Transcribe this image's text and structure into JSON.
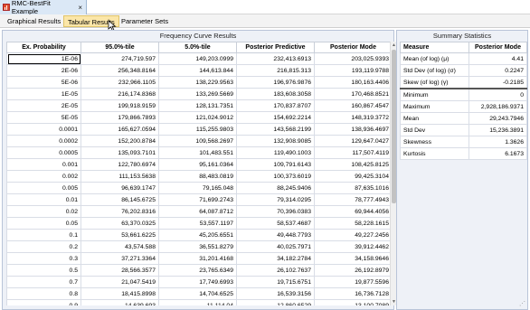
{
  "window": {
    "title": "RMC-BestFit Example",
    "close_glyph": "×"
  },
  "tabs": [
    {
      "label": "Graphical Results"
    },
    {
      "label": "Tabular Results"
    },
    {
      "label": "Parameter Sets"
    }
  ],
  "frequency": {
    "title": "Frequency Curve Results",
    "columns": [
      "Ex. Probability",
      "95.0%-tile",
      "5.0%-tile",
      "Posterior Predictive",
      "Posterior Mode"
    ],
    "rows": [
      [
        "1E-06",
        "274,719.597",
        "149,203.0999",
        "232,413.6913",
        "203,025.9393"
      ],
      [
        "2E-06",
        "256,348.8164",
        "144,613.844",
        "216,815.313",
        "193,119.9788"
      ],
      [
        "5E-06",
        "232,966.1105",
        "138,229.9563",
        "196,976.9876",
        "180,163.4406"
      ],
      [
        "1E-05",
        "216,174.8368",
        "133,269.5669",
        "183,608.3058",
        "170,468.8521"
      ],
      [
        "2E-05",
        "199,918.9159",
        "128,131.7351",
        "170,837.8707",
        "160,867.4547"
      ],
      [
        "5E-05",
        "179,866.7893",
        "121,024.9012",
        "154,692.2214",
        "148,319.3772"
      ],
      [
        "0.0001",
        "165,627.0594",
        "115,255.9803",
        "143,568.2199",
        "138,936.4697"
      ],
      [
        "0.0002",
        "152,200.8784",
        "109,568.2697",
        "132,908.9085",
        "129,647.0427"
      ],
      [
        "0.0005",
        "135,093.7101",
        "101,483.551",
        "119,490.1003",
        "117,507.4119"
      ],
      [
        "0.001",
        "122,780.6974",
        "95,161.0364",
        "109,791.6143",
        "108,425.8125"
      ],
      [
        "0.002",
        "111,153.5638",
        "88,483.0819",
        "100,373.6019",
        "99,425.3104"
      ],
      [
        "0.005",
        "96,639.1747",
        "79,165.048",
        "88,245.9406",
        "87,635.1016"
      ],
      [
        "0.01",
        "86,145.6725",
        "71,699.2743",
        "79,314.0295",
        "78,777.4943"
      ],
      [
        "0.02",
        "76,202.8316",
        "64,087.8712",
        "70,396.0383",
        "69,944.4056"
      ],
      [
        "0.05",
        "63,370.0325",
        "53,557.1197",
        "58,537.4687",
        "58,228.1615"
      ],
      [
        "0.1",
        "53,661.6225",
        "45,205.6551",
        "49,448.7793",
        "49,227.2456"
      ],
      [
        "0.2",
        "43,574.588",
        "36,551.8279",
        "40,025.7971",
        "39,912.4462"
      ],
      [
        "0.3",
        "37,271.3364",
        "31,201.4168",
        "34,182.2784",
        "34,158.9646"
      ],
      [
        "0.5",
        "28,566.3577",
        "23,765.6349",
        "26,102.7637",
        "26,192.8979"
      ],
      [
        "0.7",
        "21,047.5419",
        "17,749.6993",
        "19,715.6751",
        "19,877.5596"
      ],
      [
        "0.8",
        "18,415.8998",
        "14,704.6525",
        "16,539.3156",
        "16,736.7128"
      ],
      [
        "0.9",
        "14,639.693",
        "11,114.04",
        "12,860.6529",
        "13,100.7089"
      ]
    ]
  },
  "summary": {
    "title": "Summary Statistics",
    "columns": [
      "Measure",
      "Posterior Mode"
    ],
    "rows": [
      [
        "Mean (of log) (μ)",
        "4.41"
      ],
      [
        "Std Dev (of log) (σ)",
        "0.2247"
      ],
      [
        "Skew (of log) (γ)",
        "-0.2185"
      ],
      [
        "Minimum",
        "0"
      ],
      [
        "Maximum",
        "2,928,186.9371"
      ],
      [
        "Mean",
        "29,243.7946"
      ],
      [
        "Std Dev",
        "15,236.3891"
      ],
      [
        "Skewness",
        "1.3626"
      ],
      [
        "Kurtosis",
        "6.1673"
      ]
    ]
  },
  "colors": {
    "active_tab": "#fbe6a8",
    "panel_bg": "#eef1f7",
    "doc_tab": "#dbe8f6"
  }
}
